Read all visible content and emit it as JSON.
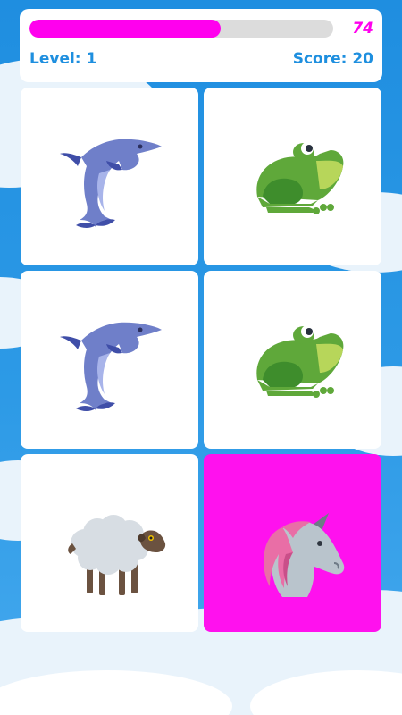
{
  "hud": {
    "progress": 0.63,
    "timer": "74",
    "level_label": "Level: 1",
    "score_label": "Score: 20"
  },
  "colors": {
    "accent": "#ff00ee",
    "text_blue": "#1e8fdf",
    "card_selected": "#ff11ee",
    "card_default": "#ffffff"
  },
  "cards": [
    {
      "animal": "dolphin-icon",
      "state": "revealed"
    },
    {
      "animal": "frog-icon",
      "state": "revealed"
    },
    {
      "animal": "dolphin-icon",
      "state": "revealed"
    },
    {
      "animal": "frog-icon",
      "state": "revealed"
    },
    {
      "animal": "sheep-icon",
      "state": "revealed"
    },
    {
      "animal": "unicorn-icon",
      "state": "selected"
    }
  ]
}
